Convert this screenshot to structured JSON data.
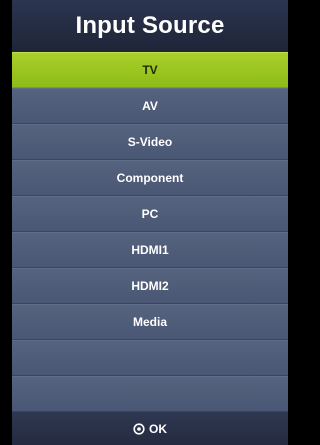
{
  "menu": {
    "title": "Input Source",
    "selected_index": 0,
    "items": [
      {
        "label": "TV"
      },
      {
        "label": "AV"
      },
      {
        "label": "S-Video"
      },
      {
        "label": "Component"
      },
      {
        "label": "PC"
      },
      {
        "label": "HDMI1"
      },
      {
        "label": "HDMI2"
      },
      {
        "label": "Media"
      },
      {
        "label": ""
      },
      {
        "label": ""
      }
    ]
  },
  "footer": {
    "ok_icon": "ok-button-icon",
    "ok_label": "OK"
  },
  "colors": {
    "selected_highlight": "#9cc520",
    "menu_background": "#4c5a78",
    "title_background": "#252d44"
  }
}
